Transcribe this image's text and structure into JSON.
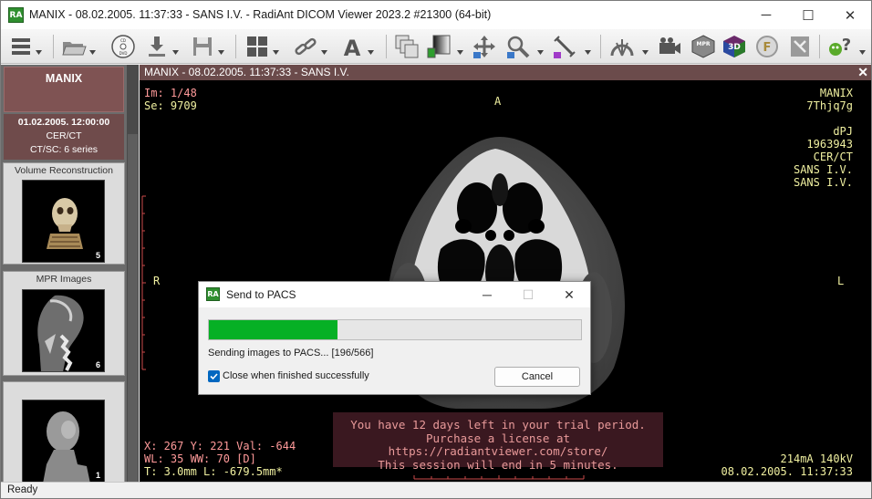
{
  "window": {
    "title": "MANIX - 08.02.2005. 11:37:33 - SANS I.V. - RadiAnt DICOM Viewer 2023.2  #21300 (64-bit)",
    "logo": "RA",
    "minimize_icon": "─",
    "maximize_icon": "☐",
    "close_icon": "✕"
  },
  "toolbar": {
    "icons": [
      "menu-icon",
      "open-folder-icon",
      "cd-dvd-icon",
      "download-icon",
      "save-icon",
      "layout-grid-icon",
      "link-icon",
      "annotation-text-icon",
      "series-stack-icon",
      "window-level-icon",
      "pan-icon",
      "zoom-icon",
      "measure-icon",
      "scout-lines-icon",
      "movie-icon",
      "mpr-icon",
      "3d-icon",
      "fusion-icon",
      "reset-icon",
      "help-icon"
    ],
    "cd_label": "CD DVD",
    "text_label": "A",
    "mpr_label": "MPR",
    "vr_label": "3D",
    "fusion_label": "F"
  },
  "sidebar": {
    "study_name": "MANIX",
    "study_date": "01.02.2005. 12:00:00",
    "study_modality": "CER/CT",
    "study_series": "CT/SC: 6 series",
    "series": [
      {
        "label": "Volume Reconstruction",
        "count": "5"
      },
      {
        "label": "MPR Images",
        "count": "6"
      },
      {
        "label": "",
        "count": "1"
      }
    ]
  },
  "viewer": {
    "header": "MANIX  - 08.02.2005. 11:37:33 - SANS I.V.",
    "close_icon": "✕",
    "top_left": [
      "Im: 1/48",
      "Se: 9709"
    ],
    "top_right": [
      "MANIX",
      "7Thjq7g",
      "",
      "dPJ",
      "1963943",
      "CER/CT",
      "SANS I.V.",
      "SANS I.V."
    ],
    "orientation": {
      "top": "A",
      "left": "R",
      "right": "L"
    },
    "bottom_left": [
      "X: 267 Y: 221 Val: -644",
      "WL: 35 WW: 70 [D]",
      "T: 3.0mm L: -679.5mm*"
    ],
    "bottom_right": [
      "214mA 140kV",
      "08.02.2005. 11:37:33"
    ],
    "trial_lines": [
      "You have 12 days left in your trial period.",
      "Purchase a license at https://radiantviewer.com/store/",
      "This session will end in 5 minutes."
    ]
  },
  "dialog": {
    "logo": "RA",
    "title": "Send to PACS",
    "minimize_icon": "─",
    "maximize_icon": "☐",
    "close_icon": "✕",
    "progress_fraction": 0.3463,
    "status": "Sending images to PACS... [196/566]",
    "checkbox_label": "Close when finished successfully",
    "checkbox_checked": true,
    "cancel_label": "Cancel"
  },
  "statusbar": {
    "text": "Ready"
  }
}
